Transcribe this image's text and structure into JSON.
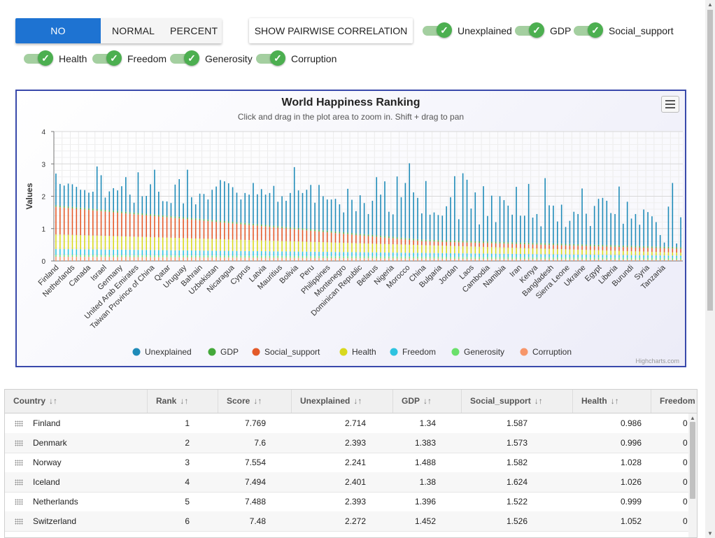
{
  "controls": {
    "stacking": [
      "NO STACKING",
      "NORMAL",
      "PERCENT"
    ],
    "pairwise_label": "SHOW PAIRWISE CORRELATION",
    "toggles": [
      {
        "label": "Unexplained",
        "checked": true
      },
      {
        "label": "GDP",
        "checked": true
      },
      {
        "label": "Social_support",
        "checked": true
      },
      {
        "label": "Health",
        "checked": true
      },
      {
        "label": "Freedom",
        "checked": true
      },
      {
        "label": "Generosity",
        "checked": true
      },
      {
        "label": "Corruption",
        "checked": true
      }
    ]
  },
  "chart_data": {
    "type": "bar",
    "title": "World Happiness Ranking",
    "subtitle": "Click and drag in the plot area to zoom in. Shift + drag to pan",
    "ylabel": "Values",
    "ylim": [
      0,
      4
    ],
    "yticks": [
      0,
      1,
      2,
      3,
      4
    ],
    "grid": true,
    "legend_position": "bottom",
    "x_tick_labels": [
      "Finland",
      "Netherlands",
      "Canada",
      "Israel",
      "Germany",
      "United Arab Emirates",
      "Taiwan Province of China",
      "Qatar",
      "Uruguay",
      "Bahrain",
      "Uzbekistan",
      "Nicaragua",
      "Cyprus",
      "Latvia",
      "Mauritius",
      "Bolivia",
      "Peru",
      "Philippines",
      "Montenegro",
      "Dominican Republic",
      "Belarus",
      "Nigeria",
      "Morocco",
      "China",
      "Bulgaria",
      "Jordan",
      "Laos",
      "Cambodia",
      "Namibia",
      "Iran",
      "Kenya",
      "Bangladesh",
      "Sierra Leone",
      "Ukraine",
      "Egypt",
      "Liberia",
      "Burundi",
      "Syria",
      "Tanzania"
    ],
    "series": [
      {
        "name": "Unexplained",
        "color": "#1f8bb8"
      },
      {
        "name": "GDP",
        "color": "#44a83a"
      },
      {
        "name": "Social_support",
        "color": "#e35a2a"
      },
      {
        "name": "Health",
        "color": "#d8d81e"
      },
      {
        "name": "Freedom",
        "color": "#2ec3e0"
      },
      {
        "name": "Generosity",
        "color": "#6be06b"
      },
      {
        "name": "Corruption",
        "color": "#f7966a"
      }
    ],
    "peaks_approx": [
      2.7,
      2.38,
      2.33,
      2.39,
      2.37,
      2.29,
      2.2,
      2.19,
      2.11,
      2.14,
      2.92,
      2.65,
      1.96,
      2.15,
      2.25,
      2.18,
      2.31,
      2.59,
      2.05,
      1.8,
      2.74,
      2.0,
      2.01,
      2.37,
      2.82,
      2.14,
      1.85,
      1.84,
      1.79,
      2.36,
      2.53,
      1.78,
      2.82,
      1.97,
      1.75,
      2.08,
      2.07,
      1.9,
      2.2,
      2.3,
      2.5,
      2.46,
      2.4,
      2.28,
      2.11,
      1.9,
      2.1,
      2.05,
      2.41,
      2.06,
      2.22,
      2.05,
      2.1,
      2.32,
      1.83,
      2.0,
      1.86,
      2.1,
      2.9,
      2.18,
      2.1,
      2.2,
      2.35,
      1.8,
      2.35,
      2.0,
      1.9,
      1.9,
      1.92,
      1.75,
      1.5,
      2.23,
      1.89,
      1.54,
      2.03,
      1.79,
      1.45,
      1.86,
      2.59,
      2.05,
      2.46,
      1.52,
      1.44,
      2.61,
      1.97,
      2.41,
      3.02,
      2.12,
      1.95,
      1.47,
      2.47,
      1.43,
      1.5,
      1.42,
      1.4,
      1.69,
      1.97,
      2.62,
      1.29,
      2.71,
      2.51,
      1.62,
      2.12,
      1.13,
      2.31,
      1.39,
      2.02,
      1.2,
      2.0,
      1.88,
      1.71,
      1.43,
      2.29,
      1.4,
      1.4,
      2.38,
      1.34,
      1.45,
      1.07,
      2.56,
      1.72,
      1.71,
      1.22,
      1.74,
      1.05,
      1.24,
      1.52,
      1.45,
      2.24,
      1.46,
      1.08,
      1.7,
      1.92,
      1.95,
      1.86,
      1.48,
      1.45,
      2.3,
      1.15,
      1.83,
      1.31,
      1.45,
      1.12,
      1.59,
      1.51,
      1.38,
      1.2,
      0.8,
      0.57,
      1.68,
      2.41,
      0.54,
      1.35
    ]
  },
  "chart_legend_colors_note": "",
  "credits": "Highcharts.com",
  "table": {
    "columns": [
      "Country",
      "Rank",
      "Score",
      "Unexplained",
      "GDP",
      "Social_support",
      "Health",
      "Freedom"
    ],
    "sort_glyph": "↓↑",
    "rows": [
      {
        "Country": "Finland",
        "Rank": "1",
        "Score": "7.769",
        "Unexplained": "2.714",
        "GDP": "1.34",
        "Social_support": "1.587",
        "Health": "0.986",
        "Freedom": "0"
      },
      {
        "Country": "Denmark",
        "Rank": "2",
        "Score": "7.6",
        "Unexplained": "2.393",
        "GDP": "1.383",
        "Social_support": "1.573",
        "Health": "0.996",
        "Freedom": "0"
      },
      {
        "Country": "Norway",
        "Rank": "3",
        "Score": "7.554",
        "Unexplained": "2.241",
        "GDP": "1.488",
        "Social_support": "1.582",
        "Health": "1.028",
        "Freedom": "0"
      },
      {
        "Country": "Iceland",
        "Rank": "4",
        "Score": "7.494",
        "Unexplained": "2.401",
        "GDP": "1.38",
        "Social_support": "1.624",
        "Health": "1.026",
        "Freedom": "0"
      },
      {
        "Country": "Netherlands",
        "Rank": "5",
        "Score": "7.488",
        "Unexplained": "2.393",
        "GDP": "1.396",
        "Social_support": "1.522",
        "Health": "0.999",
        "Freedom": "0"
      },
      {
        "Country": "Switzerland",
        "Rank": "6",
        "Score": "7.48",
        "Unexplained": "2.272",
        "GDP": "1.452",
        "Social_support": "1.526",
        "Health": "1.052",
        "Freedom": "0"
      }
    ]
  }
}
